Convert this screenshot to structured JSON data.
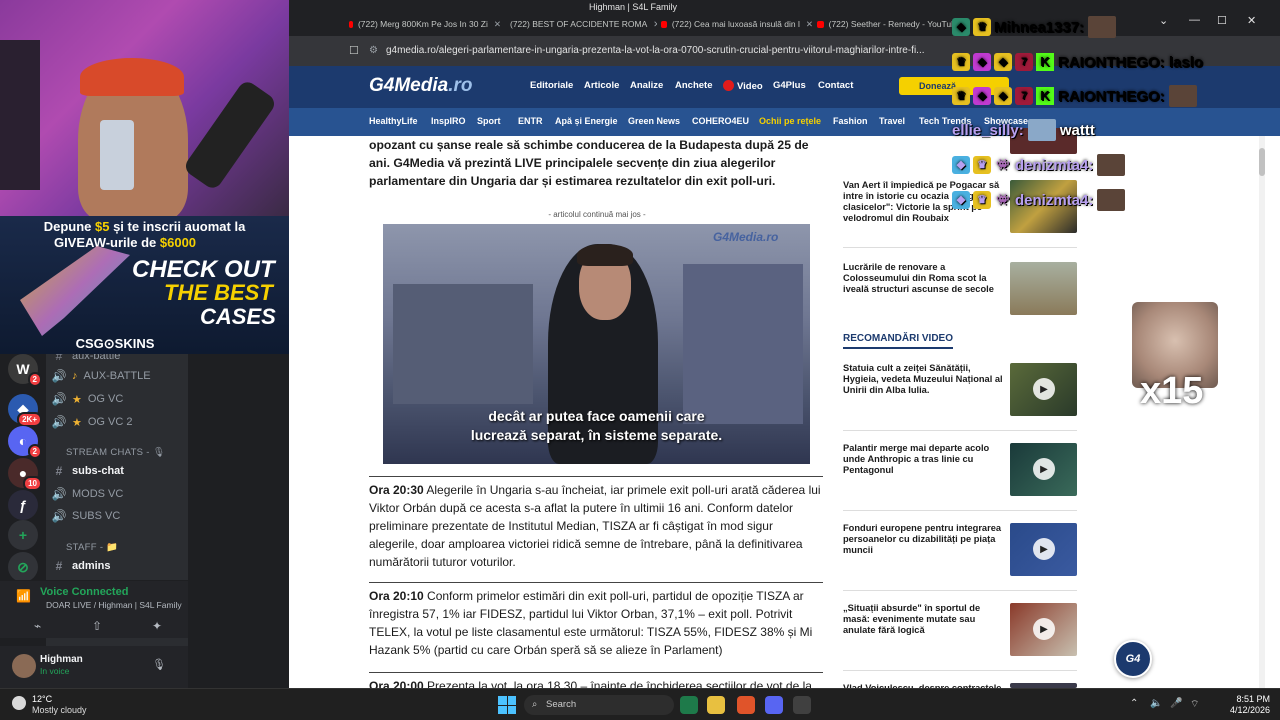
{
  "browser": {
    "window_title": "Highman | S4L Family",
    "tabs": [
      {
        "label": "(722) Merg 800Km Pe Jos In 30 Zi"
      },
      {
        "label": "(722) BEST OF ACCIDENTE ROMA"
      },
      {
        "label": "(722) Cea mai luxoasă insulă din l"
      },
      {
        "label": "(722) Seether - Remedy - YouTub"
      }
    ],
    "url": "g4media.ro/alegeri-parlamentare-in-ungaria-prezenta-la-vot-la-ora-0700-scrutin-crucial-pentru-viitorul-maghiarilor-intre-fi..."
  },
  "site": {
    "logo": "G4Media",
    "logo_suffix": ".ro",
    "nav": [
      "Editoriale",
      "Articole",
      "Analize",
      "Anchete",
      "Video",
      "G4Plus",
      "Contact"
    ],
    "donate": "Donează",
    "subnav": [
      "HealthyLife",
      "InspIRO",
      "Sport",
      "ENTR",
      "Apă și Energie",
      "Green News",
      "COHERO4EU",
      "Ochii pe rețele",
      "Fashion",
      "Travel",
      "Tech Trends",
      "Showcase ▾"
    ]
  },
  "article": {
    "lead": "opozant cu șanse reale să schimbe conducerea de la Budapesta după 25 de ani. G4Media vă prezintă LIVE principalele secvențe din ziua alegerilor parlamentare din Ungaria dar și estimarea rezultatelor din exit poll-uri.",
    "continue_note": "- articolul continuă mai jos -",
    "video_watermark": "G4Media.ro",
    "video_sub_line1": "decât ar putea face oamenii care",
    "video_sub_line2": "lucrează separat, în sisteme separate.",
    "entries": [
      {
        "time": "Ora 20:30",
        "text": " Alegerile în Ungaria s-au încheiat, iar primele exit poll-uri arată căderea lui Viktor Orbán după ce acesta s-a aflat la putere în ultimii 16 ani. Conform datelor preliminare prezentate de Institutul Median, TISZA ar fi câștigat în mod sigur alegerile, doar amploarea victoriei ridică semne de întrebare, până la definitivarea numărătorii tuturor voturilor."
      },
      {
        "time": "Ora 20:10",
        "text": "  Conform primelor estimări din exit poll-uri, partidul de opoziție TISZA ar înregistra 57, 1% iar FIDESZ, partidul lui Viktor Orban, 37,1% – exit poll. Potrivit TELEX, la votul pe liste clasamentul este următorul: TISZA 55%, FIDESZ 38% și Mi Hazank 5% (partid cu care Orbán speră să se alieze în Parlament)"
      },
      {
        "time": "Ora 20:00",
        "text": " Prezența la vot, la ora 18.30 – înainte de închiderea secțiilor de vot de la"
      }
    ]
  },
  "sidebar": {
    "top_items": [
      {
        "title": "Van Aert îl împiedică pe Pogacar să intre în istorie cu ocazia „Regina clasicelor\": Victorie la sprint pe velodromul din Roubaix"
      },
      {
        "title": "Lucrările de renovare a Colosseumului din Roma scot la iveală structuri ascunse de secole"
      }
    ],
    "video_section_title": "RECOMANDĂRI VIDEO",
    "video_items": [
      {
        "title": "Statuia cult a zeiței Sănătății, Hygieia, vedeta Muzeului Național al Unirii din Alba Iulia."
      },
      {
        "title": "Palantir merge mai departe acolo unde Anthropic a tras linie cu Pentagonul"
      },
      {
        "title": "Fonduri europene pentru integrarea persoanelor cu dizabilități pe piața muncii"
      },
      {
        "title": "„Situații absurde\" în sportul de masă: evenimente mutate sau anulate fără logică"
      },
      {
        "title": "Vlad Voiculescu, despre contractele"
      }
    ],
    "fab_label": "G4"
  },
  "discord": {
    "channels": [
      {
        "label": "aux-battle",
        "type": "text"
      },
      {
        "label": "AUX-BATTLE",
        "type": "voice"
      },
      {
        "label": "OG VC",
        "type": "voice"
      },
      {
        "label": "OG VC 2",
        "type": "voice"
      },
      {
        "label": "subs-chat",
        "type": "text"
      },
      {
        "label": "MODS VC",
        "type": "voice"
      },
      {
        "label": "SUBS VC",
        "type": "voice"
      },
      {
        "label": "admins",
        "type": "text"
      }
    ],
    "category_stream": "STREAM CHATS - 🎙",
    "category_staff": "STAFF - 📁",
    "server_badges": [
      "2",
      "2K+",
      "2",
      "10"
    ],
    "voice_title": "Voice Connected",
    "voice_sub": "DOAR LIVE / Highman | S4L Family",
    "user_name": "Highman",
    "user_status": "In voice"
  },
  "banner": {
    "line1_a": "Depune ",
    "line1_amount": "$5",
    "line1_b": " și te inscrii auomat la",
    "line2_a": "GIVEAW",
    "line2_b": "-urile de ",
    "line2_amount": "$6000",
    "co1": "CHECK OUT",
    "co2": "THE BEST",
    "co3": "CASES",
    "brand": "CSG⊙SKINS"
  },
  "chat": [
    {
      "user": "Mihnea1337:",
      "color": "#ffffff"
    },
    {
      "user": "RAIONTHEGO:",
      "msg": "laslo",
      "color": "#ffffff"
    },
    {
      "user": "RAIONTHEGO:",
      "color": "#ffffff"
    },
    {
      "user": "ellie_silly:",
      "msg": "wattt",
      "color": "#b8a0f0"
    },
    {
      "user": "denizmta4:",
      "color": "#b8a0f0"
    },
    {
      "user": "denizmta4:",
      "color": "#b8a0f0"
    }
  ],
  "overlay_counter": "x15",
  "taskbar": {
    "temp": "12°C",
    "condition": "Mostly cloudy",
    "search": "Search",
    "time": "8:51 PM",
    "date": "4/12/2026"
  }
}
